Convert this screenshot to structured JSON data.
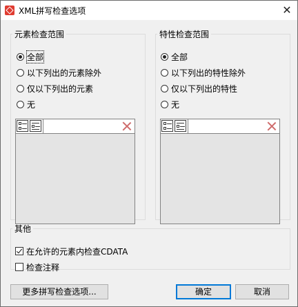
{
  "window": {
    "title": "XML拼写检查选项",
    "close_glyph": "✕"
  },
  "elements_group": {
    "legend": "元素检查范围",
    "options": [
      "全部",
      "以下列出的元素除外",
      "仅以下列出的元素",
      "无"
    ],
    "selected": 0
  },
  "attributes_group": {
    "legend": "特性检查范围",
    "options": [
      "全部",
      "以下列出的特性除外",
      "仅以下列出的特性",
      "无"
    ],
    "selected": 0
  },
  "other_group": {
    "legend": "其他",
    "cdata_label": "在允许的元素内检查CDATA",
    "cdata_checked": true,
    "comments_label": "检查注释",
    "comments_checked": false
  },
  "buttons": {
    "more": "更多拼写检查选项...",
    "ok": "确定",
    "cancel": "取消"
  },
  "icons": [
    "app-icon",
    "close-icon",
    "insert-row-icon",
    "append-row-icon",
    "delete-icon"
  ],
  "colors": {
    "accent": "#0078d7",
    "delete": "#cf6b6b",
    "app_icon": "#e03c31"
  }
}
